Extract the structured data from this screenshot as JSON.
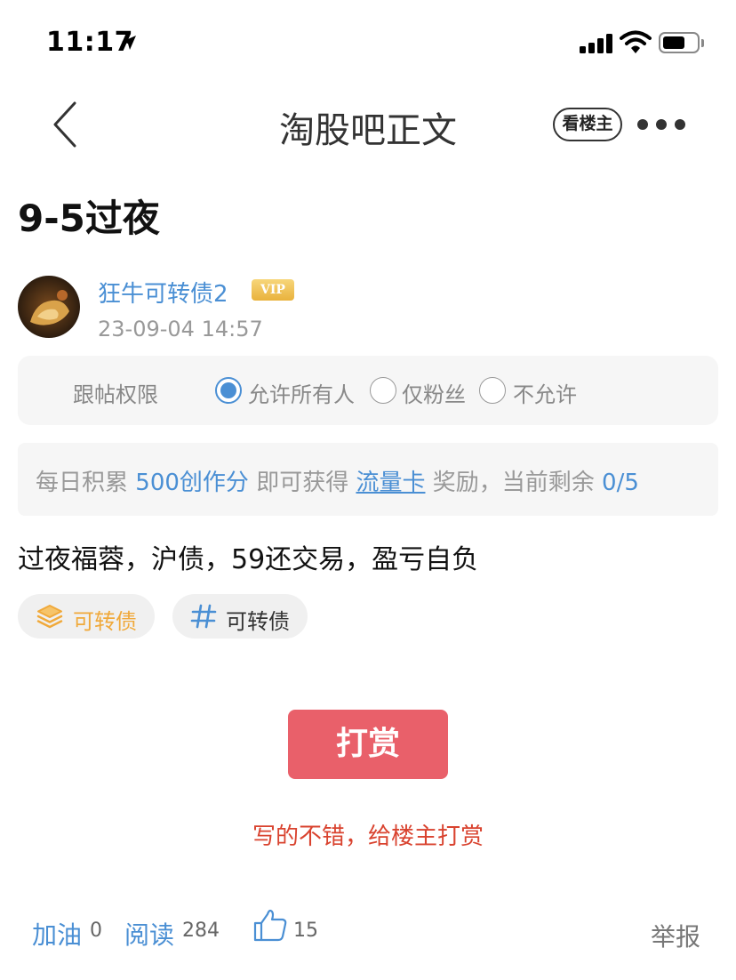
{
  "status_bar": {
    "time": "11:17"
  },
  "nav": {
    "title": "淘股吧正文",
    "op_only_label": "看楼主"
  },
  "post": {
    "title": "9-5过夜",
    "author": "狂牛可转债2",
    "vip_label": "VIP",
    "time": "23-09-04 14:57",
    "body": "过夜福蓉，沪债，59还交易，盈亏自负"
  },
  "reply_permission": {
    "label": "跟帖权限",
    "options": [
      "允许所有人",
      "仅粉丝",
      "不允许"
    ],
    "selected": "允许所有人"
  },
  "reward_notice": {
    "prefix": "每日积累",
    "points": "500创作分",
    "middle": "即可获得",
    "card": "流量卡",
    "suffix": "奖励，当前剩余",
    "remaining": "0/5"
  },
  "tags": [
    {
      "label": "可转债",
      "icon": "layers-icon",
      "color": "#f0a93a"
    },
    {
      "label": "可转债",
      "icon": "hashtag-icon",
      "color": "#4a8fd4"
    }
  ],
  "tip": {
    "button_label": "打赏",
    "hint": "写的不错，给楼主打赏"
  },
  "stats": {
    "cheer_label": "加油",
    "cheer_count": "0",
    "read_label": "阅读",
    "read_count": "284",
    "like_count": "15",
    "report_label": "举报"
  },
  "colors": {
    "accent": "#4a8fd4",
    "tip_button": "#e9606a",
    "tip_hint": "#d9432f"
  }
}
